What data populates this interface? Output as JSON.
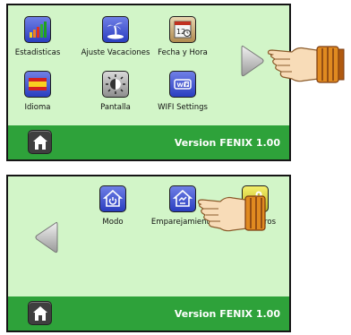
{
  "screen_top": {
    "items": [
      {
        "label": "Estadisticas",
        "icon": "bar-chart-icon"
      },
      {
        "label": "Ajuste Vacaciones",
        "icon": "palm-tree-icon"
      },
      {
        "label": "Fecha y Hora",
        "icon": "calendar-clock-icon"
      },
      {
        "label": "Idioma",
        "icon": "spain-flag-icon"
      },
      {
        "label": "Pantalla",
        "icon": "brightness-icon"
      },
      {
        "label": "WIFI Settings",
        "icon": "wifi-icon"
      }
    ],
    "nav_arrow": "next-arrow-icon",
    "footer": {
      "version": "Version FENIX 1.00",
      "home_icon": "home-icon"
    }
  },
  "screen_bottom": {
    "items": [
      {
        "label": "Modo",
        "icon": "home-power-icon"
      },
      {
        "label": "Emparejamiento",
        "icon": "home-pairing-icon"
      },
      {
        "label": "Parametros",
        "visible_label": "P",
        "visible_label_tail": "ros",
        "icon": "gears-icon"
      }
    ],
    "nav_arrow": "previous-arrow-icon",
    "footer": {
      "version": "Version FENIX 1.00",
      "home_icon": "home-icon"
    }
  },
  "colors": {
    "screen_bg": "#d2f5c8",
    "footer_bg": "#2ea23a",
    "icon_blue": "#3a4fd0",
    "icon_gray": "#a8a8a8",
    "icon_yellow": "#e6df3a"
  }
}
